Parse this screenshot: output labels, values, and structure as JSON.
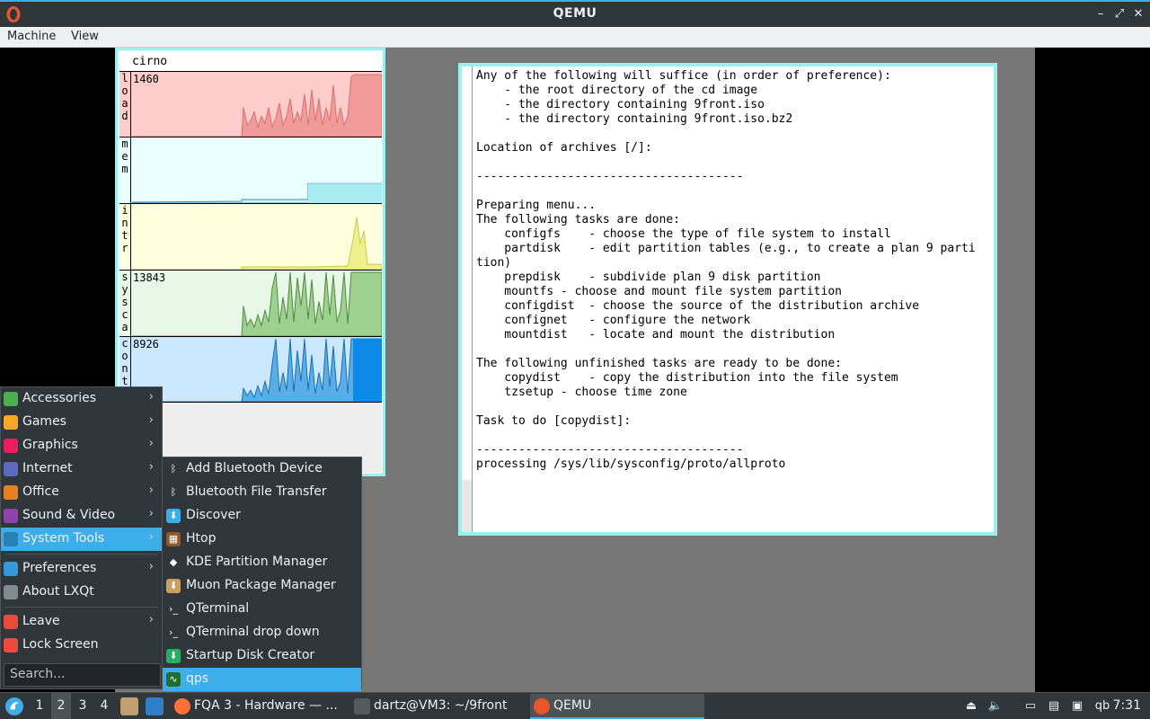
{
  "window": {
    "title": "QEMU",
    "menus": [
      "Machine",
      "View"
    ],
    "controls": {
      "minimize": "–",
      "restore": "⤢",
      "close": "✕"
    }
  },
  "stats": {
    "hostname": "cirno",
    "graphs": [
      {
        "label": "load",
        "value": "1460",
        "color": "#ffcccc",
        "line": "#e88a8a"
      },
      {
        "label": "mem",
        "value": "",
        "color": "#eaffff",
        "line": "#7fd8e8"
      },
      {
        "label": "intr",
        "value": "",
        "color": "#ffffdd",
        "line": "#d8d870"
      },
      {
        "label": "sysca",
        "value": "13843",
        "color": "#e8f8e8",
        "line": "#66aa55"
      },
      {
        "label": "cont",
        "value": "8926",
        "color": "#cce8ff",
        "line": "#1f8fe0"
      }
    ]
  },
  "terminal": {
    "lines": [
      "Any of the following will suffice (in order of preference):",
      "    - the root directory of the cd image",
      "    - the directory containing 9front.iso",
      "    - the directory containing 9front.iso.bz2",
      "",
      "Location of archives [/]:",
      "",
      "--------------------------------------",
      "",
      "Preparing menu...",
      "The following tasks are done:",
      "    configfs    - choose the type of file system to install",
      "    partdisk    - edit partition tables (e.g., to create a plan 9 parti",
      "tion)",
      "    prepdisk    - subdivide plan 9 disk partition",
      "    mountfs - choose and mount file system partition",
      "    configdist  - choose the source of the distribution archive",
      "    confignet   - configure the network",
      "    mountdist   - locate and mount the distribution",
      "",
      "The following unfinished tasks are ready to be done:",
      "    copydist    - copy the distribution into the file system",
      "    tzsetup - choose time zone",
      "",
      "Task to do [copydist]:",
      "",
      "--------------------------------------",
      "processing /sys/lib/sysconfig/proto/allproto"
    ]
  },
  "start_menu": {
    "items": [
      {
        "label": "Accessories",
        "icon": "accessories-icon",
        "color": "#4caf50",
        "arrow": "›"
      },
      {
        "label": "Games",
        "icon": "games-icon",
        "color": "#f9a825",
        "arrow": "›"
      },
      {
        "label": "Graphics",
        "icon": "graphics-icon",
        "color": "#e91e63",
        "arrow": "›"
      },
      {
        "label": "Internet",
        "icon": "internet-icon",
        "color": "#5c6bc0",
        "arrow": "›"
      },
      {
        "label": "Office",
        "icon": "office-icon",
        "color": "#e67e22",
        "arrow": "›"
      },
      {
        "label": "Sound & Video",
        "icon": "sound-video-icon",
        "color": "#8e44ad",
        "arrow": "›"
      },
      {
        "label": "System Tools",
        "icon": "system-tools-icon",
        "color": "#2980b9",
        "arrow": "›"
      },
      {
        "label": "Preferences",
        "icon": "preferences-icon",
        "color": "#3498db",
        "arrow": "›"
      },
      {
        "label": "About LXQt",
        "icon": "info-icon",
        "color": "#7f8c8d",
        "arrow": ""
      },
      {
        "label": "Leave",
        "icon": "power-icon",
        "color": "#e74c3c",
        "arrow": "›"
      },
      {
        "label": "Lock Screen",
        "icon": "lock-icon",
        "color": "#e74c3c",
        "arrow": ""
      }
    ],
    "search_placeholder": "Search..."
  },
  "submenu": {
    "items": [
      {
        "label": "Add Bluetooth Device",
        "icon": "bluetooth-icon",
        "glyph": "ᛒ",
        "color": "#31363b"
      },
      {
        "label": "Bluetooth File Transfer",
        "icon": "bluetooth-icon",
        "glyph": "ᛒ",
        "color": "#31363b"
      },
      {
        "label": "Discover",
        "icon": "discover-icon",
        "glyph": "⬇",
        "color": "#3daee9"
      },
      {
        "label": "Htop",
        "icon": "htop-icon",
        "glyph": "▦",
        "color": "#8b5a2b"
      },
      {
        "label": "KDE Partition Manager",
        "icon": "partition-manager-icon",
        "glyph": "◆",
        "color": "#31363b"
      },
      {
        "label": "Muon Package Manager",
        "icon": "muon-icon",
        "glyph": "⬇",
        "color": "#c8a060"
      },
      {
        "label": "QTerminal",
        "icon": "terminal-icon",
        "glyph": "›_",
        "color": "#31363b"
      },
      {
        "label": "QTerminal drop down",
        "icon": "terminal-icon",
        "glyph": "›_",
        "color": "#31363b"
      },
      {
        "label": "Startup Disk Creator",
        "icon": "startup-disk-icon",
        "glyph": "⬇",
        "color": "#27ae60"
      },
      {
        "label": "qps",
        "icon": "qps-icon",
        "glyph": "∿",
        "color": "#1e6e2e"
      }
    ]
  },
  "taskbar": {
    "workspaces": [
      "1",
      "2",
      "3",
      "4"
    ],
    "tasks": [
      {
        "label": "FQA 3 - Hardware — ...",
        "icon": "firefox-icon",
        "color": "#ff7139"
      },
      {
        "label": "dartz@VM3: ~/9front",
        "icon": "terminal-icon",
        "color": "#555a5f"
      },
      {
        "label": "QEMU",
        "icon": "qemu-icon",
        "color": "#e8552a"
      }
    ],
    "tray_text": "qb",
    "clock": "7:31"
  }
}
